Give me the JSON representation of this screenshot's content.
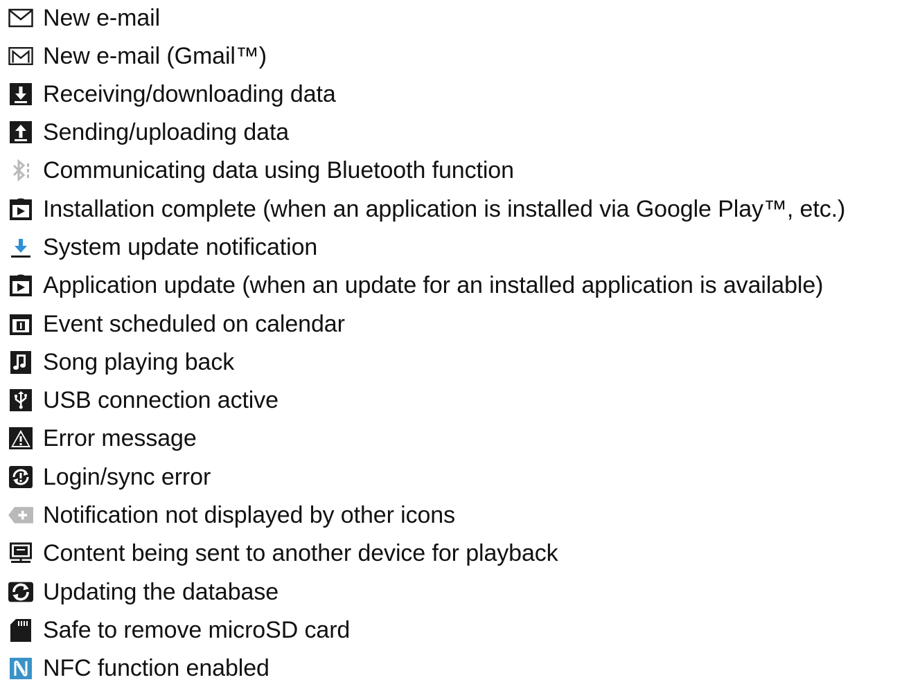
{
  "items": [
    {
      "icon": "envelope-icon",
      "label": "New e-mail"
    },
    {
      "icon": "gmail-icon",
      "label": "New e-mail (Gmail™)"
    },
    {
      "icon": "download-arrow-icon",
      "label": "Receiving/downloading data"
    },
    {
      "icon": "upload-arrow-icon",
      "label": "Sending/uploading data"
    },
    {
      "icon": "bluetooth-data-icon",
      "label": "Communicating data using Bluetooth function"
    },
    {
      "icon": "install-complete-icon",
      "label": "Installation complete (when an application is installed via Google Play™, etc.)"
    },
    {
      "icon": "system-update-icon",
      "label": "System update notification"
    },
    {
      "icon": "app-update-icon",
      "label": "Application update (when an update for an installed application is available)"
    },
    {
      "icon": "calendar-icon",
      "label": "Event scheduled on calendar"
    },
    {
      "icon": "music-note-icon",
      "label": "Song playing back"
    },
    {
      "icon": "usb-icon",
      "label": "USB connection active"
    },
    {
      "icon": "warning-icon",
      "label": "Error message"
    },
    {
      "icon": "sync-error-icon",
      "label": "Login/sync error"
    },
    {
      "icon": "more-notifications-icon",
      "label": "Notification not displayed by other icons"
    },
    {
      "icon": "media-share-icon",
      "label": "Content being sent to another device for playback"
    },
    {
      "icon": "database-update-icon",
      "label": "Updating the database"
    },
    {
      "icon": "sd-card-icon",
      "label": "Safe to remove microSD card"
    },
    {
      "icon": "nfc-icon",
      "label": "NFC function enabled"
    }
  ],
  "colors": {
    "text": "#111111",
    "icon_dark": "#1a1a1a",
    "system_update_blue": "#2f8fd6",
    "nfc_blue": "#3a93c8",
    "light_gray": "#b9b9b9"
  }
}
